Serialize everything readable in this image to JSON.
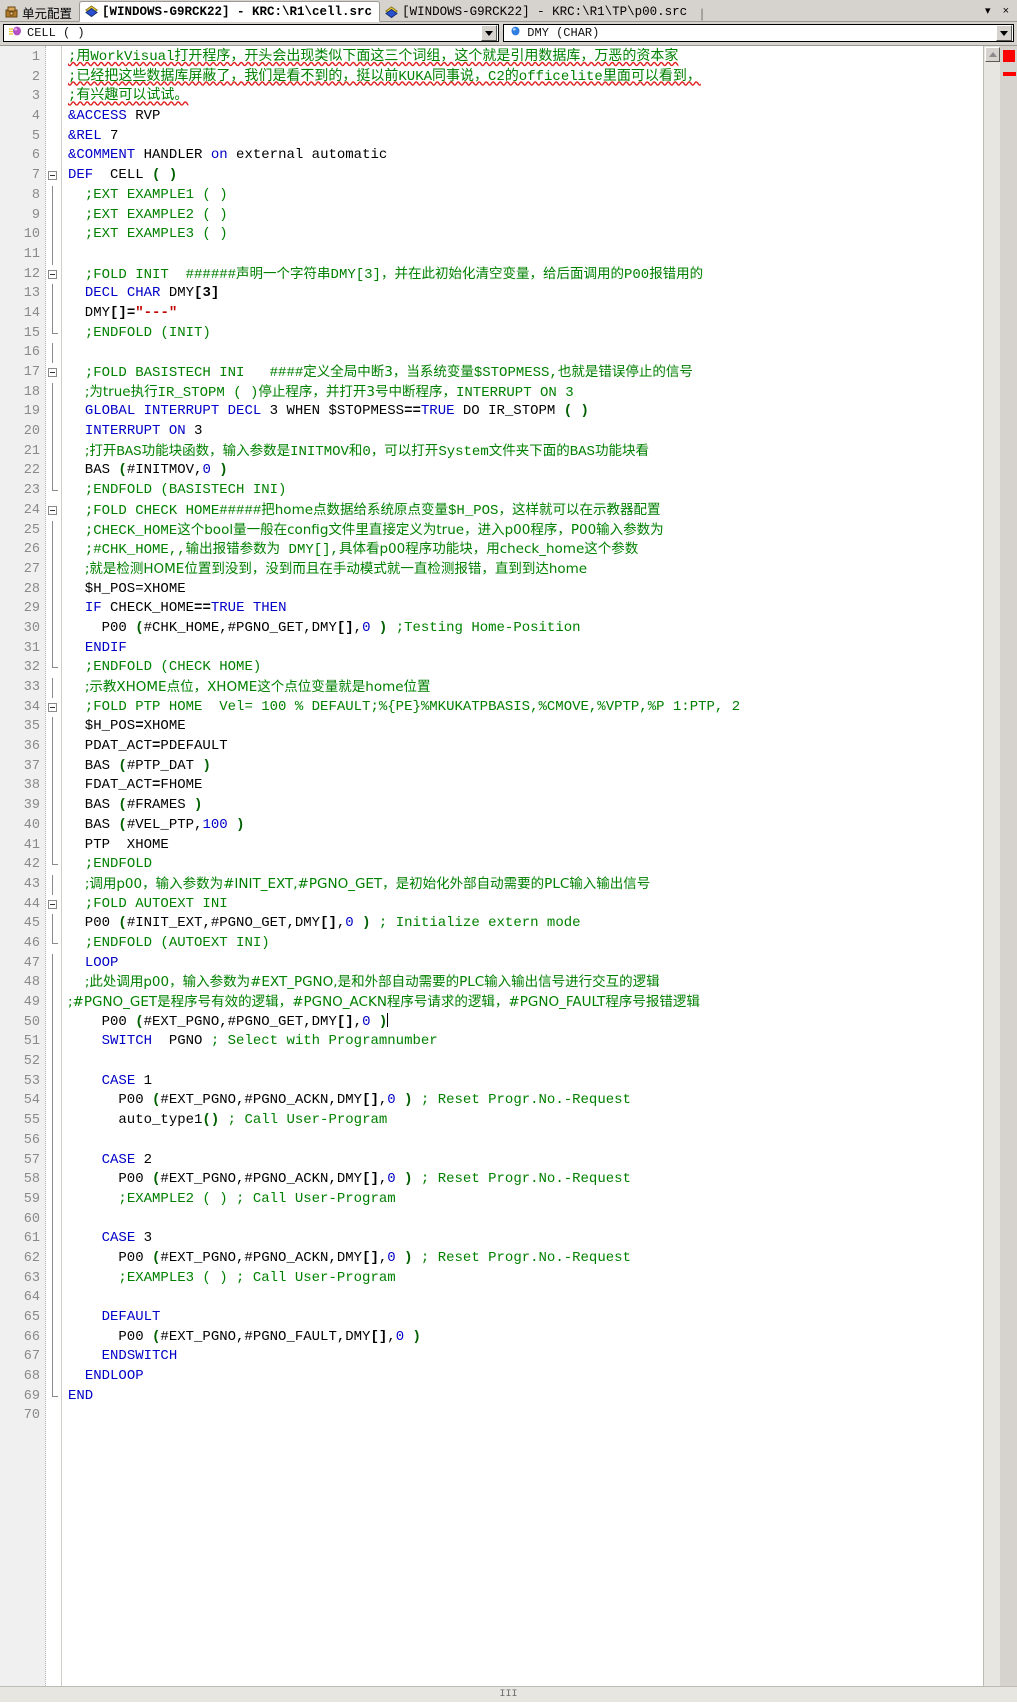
{
  "window": {
    "tabs": [
      {
        "label": "单元配置",
        "icon": "cell-config-icon",
        "active": false
      },
      {
        "label": "[WINDOWS-G9RCK22] - KRC:\\R1\\cell.src",
        "icon": "source-file-icon",
        "active": true
      },
      {
        "label": "[WINDOWS-G9RCK22] - KRC:\\R1\\TP\\p00.src",
        "icon": "source-file-icon",
        "active": false
      }
    ],
    "tab_separator": "|",
    "tab_menu_label": "▾",
    "tab_close_label": "×"
  },
  "declaration_bar": {
    "left_combo": {
      "value": "CELL ( )",
      "icon": "module-icon"
    },
    "right_combo": {
      "value": "DMY (CHAR)",
      "icon": "variable-icon"
    }
  },
  "editor": {
    "first_line": 1,
    "total_lines": 70,
    "cursor_line": 50,
    "lines": [
      {
        "n": 1,
        "fold": "",
        "html": "<span class=\"cm ul\">;用WorkVisual打开程序，开头会出现类似下面这三个词组，这个就是引用数据库，万恶的资本家</span>"
      },
      {
        "n": 2,
        "fold": "",
        "html": "<span class=\"cm ul\">;已经把这些数据库屏蔽了，我们是看不到的，挺以前KUKA同事说，C2的officelite里面可以看到，</span>"
      },
      {
        "n": 3,
        "fold": "",
        "html": "<span class=\"cm ul\">;有兴趣可以试试。</span>"
      },
      {
        "n": 4,
        "fold": "",
        "html": "<span class=\"kw\">&amp;ACCESS</span> RVP"
      },
      {
        "n": 5,
        "fold": "",
        "html": "<span class=\"kw\">&amp;REL</span> 7"
      },
      {
        "n": 6,
        "fold": "",
        "html": "<span class=\"kw\">&amp;COMMENT</span> HANDLER <span class=\"kw\">on</span> external automatic"
      },
      {
        "n": 7,
        "fold": "box",
        "html": "<span class=\"kw\">DEF</span>  CELL <span class=\"pn\">( )</span>"
      },
      {
        "n": 8,
        "fold": "line",
        "html": "  <span class=\"cm\">;EXT EXAMPLE1 ( )</span>"
      },
      {
        "n": 9,
        "fold": "line",
        "html": "  <span class=\"cm\">;EXT EXAMPLE2 ( )</span>"
      },
      {
        "n": 10,
        "fold": "line",
        "html": "  <span class=\"cm\">;EXT EXAMPLE3 ( )</span>"
      },
      {
        "n": 11,
        "fold": "line",
        "html": ""
      },
      {
        "n": 12,
        "fold": "boxline",
        "html": "  <span class=\"cm\">;FOLD INIT  ######</span><span class=\"cmz\">声明一个字符串</span><span class=\"cm\">DMY[3]</span><span class=\"cmz\">，并在此初始化清空变量，给后面调用的</span><span class=\"cm\">P00</span><span class=\"cmz\">报错用的</span>"
      },
      {
        "n": 13,
        "fold": "line",
        "html": "  <span class=\"kw\">DECL CHAR</span> DMY<span class=\"op\">[3]</span>"
      },
      {
        "n": 14,
        "fold": "line",
        "html": "  DMY<span class=\"op\">[]=</span><span class=\"str\">\"---\"</span>"
      },
      {
        "n": 15,
        "fold": "endline",
        "html": "  <span class=\"cm\">;ENDFOLD (INIT)</span>"
      },
      {
        "n": 16,
        "fold": "line",
        "html": ""
      },
      {
        "n": 17,
        "fold": "boxline",
        "html": "  <span class=\"cm\">;FOLD BASISTECH INI   ####</span><span class=\"cmz\">定义全局中断3，当系统变量</span><span class=\"cm\">$STOPMESS,</span><span class=\"cmz\">也就是错误停止的信号</span>"
      },
      {
        "n": 18,
        "fold": "line",
        "html": "  <span class=\"cmz\">;为true执行</span><span class=\"cm\">IR_STOPM ( )</span><span class=\"cmz\">停止程序，并打开3号中断程序，</span><span class=\"cm\">INTERRUPT ON 3</span>"
      },
      {
        "n": 19,
        "fold": "line",
        "html": "  <span class=\"kw\">GLOBAL INTERRUPT DECL</span> 3 WHEN $STOPMESS<span class=\"op\">==</span><span class=\"kw\">TRUE</span> DO IR_STOPM <span class=\"pn\">( )</span>"
      },
      {
        "n": 20,
        "fold": "line",
        "html": "  <span class=\"kw\">INTERRUPT ON</span> 3"
      },
      {
        "n": 21,
        "fold": "line",
        "html": "  <span class=\"cmz\">;打开</span><span class=\"cm\">BAS</span><span class=\"cmz\">功能块函数，输入参数是</span><span class=\"cm\">INITMOV</span><span class=\"cmz\">和</span><span class=\"cm\">0</span><span class=\"cmz\">，可以打开</span><span class=\"cm\">System</span><span class=\"cmz\">文件夹下面的</span><span class=\"cm\">BAS</span><span class=\"cmz\">功能块看</span>"
      },
      {
        "n": 22,
        "fold": "line",
        "html": "  BAS <span class=\"pn\">(</span>#INITMOV,<span class=\"num\">0</span> <span class=\"pn\">)</span>"
      },
      {
        "n": 23,
        "fold": "endline",
        "html": "  <span class=\"cm\">;ENDFOLD (BASISTECH INI)</span>"
      },
      {
        "n": 24,
        "fold": "boxline",
        "html": "  <span class=\"cm\">;FOLD CHECK HOME#####</span><span class=\"cmz\">把home点数据给系统原点变量</span><span class=\"cm\">$H_POS</span><span class=\"cmz\">，这样就可以在示教器配置</span>"
      },
      {
        "n": 25,
        "fold": "line",
        "html": "  <span class=\"cm\">;CHECK_HOME</span><span class=\"cmz\">这个bool量一般在config文件里直接定义为true，进入p00程序，P00输入参数为</span>"
      },
      {
        "n": 26,
        "fold": "line",
        "html": "  <span class=\"cm\">;#CHK_HOME,,</span><span class=\"cmz\">输出报错参数为</span><span class=\"cm\"> DMY[],</span><span class=\"cmz\">具体看p00程序功能块，用check_home这个参数</span>"
      },
      {
        "n": 27,
        "fold": "line",
        "html": "  <span class=\"cmz\">;就是检测HOME位置到没到，没到而且在手动模式就一直检测报错，直到到达home</span>"
      },
      {
        "n": 28,
        "fold": "line",
        "html": "  $H_POS=XHOME"
      },
      {
        "n": 29,
        "fold": "line",
        "html": "  <span class=\"kw\">IF</span> CHECK_HOME<span class=\"op\">==</span><span class=\"kw\">TRUE THEN</span>"
      },
      {
        "n": 30,
        "fold": "line",
        "html": "    P00 <span class=\"pn\">(</span>#CHK_HOME,#PGNO_GET,DMY<span class=\"op\">[]</span>,<span class=\"num\">0</span> <span class=\"pn\">)</span> <span class=\"cm\">;Testing Home-Position</span>"
      },
      {
        "n": 31,
        "fold": "line",
        "html": "  <span class=\"kw\">ENDIF</span>"
      },
      {
        "n": 32,
        "fold": "endline",
        "html": "  <span class=\"cm\">;ENDFOLD (CHECK HOME)</span>"
      },
      {
        "n": 33,
        "fold": "line",
        "html": "  <span class=\"cmz\">;示教XHOME点位，XHOME这个点位变量就是home位置</span>"
      },
      {
        "n": 34,
        "fold": "boxline",
        "html": "  <span class=\"cm\">;FOLD PTP HOME  Vel= 100 % DEFAULT;%{PE}%MKUKATPBASIS,%CMOVE,%VPTP,%P 1:PTP, 2</span>"
      },
      {
        "n": 35,
        "fold": "line",
        "html": "  $H_POS<span class=\"op\">=</span>XHOME"
      },
      {
        "n": 36,
        "fold": "line",
        "html": "  PDAT_ACT<span class=\"op\">=</span>PDEFAULT"
      },
      {
        "n": 37,
        "fold": "line",
        "html": "  BAS <span class=\"pn\">(</span>#PTP_DAT <span class=\"pn\">)</span>"
      },
      {
        "n": 38,
        "fold": "line",
        "html": "  FDAT_ACT<span class=\"op\">=</span>FHOME"
      },
      {
        "n": 39,
        "fold": "line",
        "html": "  BAS <span class=\"pn\">(</span>#FRAMES <span class=\"pn\">)</span>"
      },
      {
        "n": 40,
        "fold": "line",
        "html": "  BAS <span class=\"pn\">(</span>#VEL_PTP,<span class=\"num\">100</span> <span class=\"pn\">)</span>"
      },
      {
        "n": 41,
        "fold": "line",
        "html": "  PTP  XHOME"
      },
      {
        "n": 42,
        "fold": "endline",
        "html": "  <span class=\"cm\">;ENDFOLD</span>"
      },
      {
        "n": 43,
        "fold": "line",
        "html": "  <span class=\"cmz\">;调用p00，输入参数为#INIT_EXT,#PGNO_GET，是初始化外部自动需要的PLC输入输出信号</span>"
      },
      {
        "n": 44,
        "fold": "boxline",
        "html": "  <span class=\"cm\">;FOLD AUTOEXT INI</span>"
      },
      {
        "n": 45,
        "fold": "line",
        "html": "  P00 <span class=\"pn\">(</span>#INIT_EXT,#PGNO_GET,DMY<span class=\"op\">[]</span>,<span class=\"num\">0</span> <span class=\"pn\">)</span> <span class=\"cm\">; Initialize extern mode</span>"
      },
      {
        "n": 46,
        "fold": "endline",
        "html": "  <span class=\"cm\">;ENDFOLD (AUTOEXT INI)</span>"
      },
      {
        "n": 47,
        "fold": "line",
        "html": "  <span class=\"kw\">LOOP</span>"
      },
      {
        "n": 48,
        "fold": "line",
        "html": "  <span class=\"cmz\">;此处调用p00，输入参数为#EXT_PGNO,是和外部自动需要的PLC输入输出信号进行交互的逻辑</span>"
      },
      {
        "n": 49,
        "fold": "line",
        "html": "<span class=\"cmz\">;#PGNO_GET是程序号有效的逻辑，#PGNO_ACKN程序号请求的逻辑，#PGNO_FAULT程序号报错逻辑</span>"
      },
      {
        "n": 50,
        "fold": "line",
        "html": "    P00 <span class=\"pn\">(</span>#EXT_PGNO,#PGNO_GET,DMY<span class=\"op\">[]</span>,<span class=\"num\">0</span> <span class=\"pn\">)</span><span class=\"cursor\"></span>"
      },
      {
        "n": 51,
        "fold": "line",
        "html": "    <span class=\"kw\">SWITCH</span>  PGNO <span class=\"cm\">; Select with Programnumber</span>"
      },
      {
        "n": 52,
        "fold": "line",
        "html": ""
      },
      {
        "n": 53,
        "fold": "line",
        "html": "    <span class=\"kw\">CASE</span> 1"
      },
      {
        "n": 54,
        "fold": "line",
        "html": "      P00 <span class=\"pn\">(</span>#EXT_PGNO,#PGNO_ACKN,DMY<span class=\"op\">[]</span>,<span class=\"num\">0</span> <span class=\"pn\">)</span> <span class=\"cm\">; Reset Progr.No.-Request</span>"
      },
      {
        "n": 55,
        "fold": "line",
        "html": "      auto_type1<span class=\"pn\">()</span> <span class=\"cm\">; Call User-Program</span>"
      },
      {
        "n": 56,
        "fold": "line",
        "html": ""
      },
      {
        "n": 57,
        "fold": "line",
        "html": "    <span class=\"kw\">CASE</span> 2"
      },
      {
        "n": 58,
        "fold": "line",
        "html": "      P00 <span class=\"pn\">(</span>#EXT_PGNO,#PGNO_ACKN,DMY<span class=\"op\">[]</span>,<span class=\"num\">0</span> <span class=\"pn\">)</span> <span class=\"cm\">; Reset Progr.No.-Request</span>"
      },
      {
        "n": 59,
        "fold": "line",
        "html": "      <span class=\"cm\">;EXAMPLE2 ( ) ; Call User-Program</span>"
      },
      {
        "n": 60,
        "fold": "line",
        "html": ""
      },
      {
        "n": 61,
        "fold": "line",
        "html": "    <span class=\"kw\">CASE</span> 3"
      },
      {
        "n": 62,
        "fold": "line",
        "html": "      P00 <span class=\"pn\">(</span>#EXT_PGNO,#PGNO_ACKN,DMY<span class=\"op\">[]</span>,<span class=\"num\">0</span> <span class=\"pn\">)</span> <span class=\"cm\">; Reset Progr.No.-Request</span>"
      },
      {
        "n": 63,
        "fold": "line",
        "html": "      <span class=\"cm\">;EXAMPLE3 ( ) ; Call User-Program</span>"
      },
      {
        "n": 64,
        "fold": "line",
        "html": ""
      },
      {
        "n": 65,
        "fold": "line",
        "html": "    <span class=\"kw\">DEFAULT</span>"
      },
      {
        "n": 66,
        "fold": "line",
        "html": "      P00 <span class=\"pn\">(</span>#EXT_PGNO,#PGNO_FAULT,DMY<span class=\"op\">[]</span>,<span class=\"num\">0</span> <span class=\"pn\">)</span>"
      },
      {
        "n": 67,
        "fold": "line",
        "html": "    <span class=\"kw\">ENDSWITCH</span>"
      },
      {
        "n": 68,
        "fold": "line",
        "html": "  <span class=\"kw\">ENDLOOP</span>"
      },
      {
        "n": 69,
        "fold": "endline",
        "html": "<span class=\"kw\">END</span>"
      },
      {
        "n": 70,
        "fold": "",
        "html": ""
      }
    ]
  },
  "scrollbars": {
    "vertical_up_label": "▲",
    "horizontal_grip_label": "III"
  },
  "colors": {
    "comment": "#008000",
    "keyword": "#0000c8",
    "string": "#c00000",
    "paren": "#006000",
    "spell_underline": "#e02020",
    "marker": "#ff0000",
    "chrome": "#d6d3ce"
  }
}
